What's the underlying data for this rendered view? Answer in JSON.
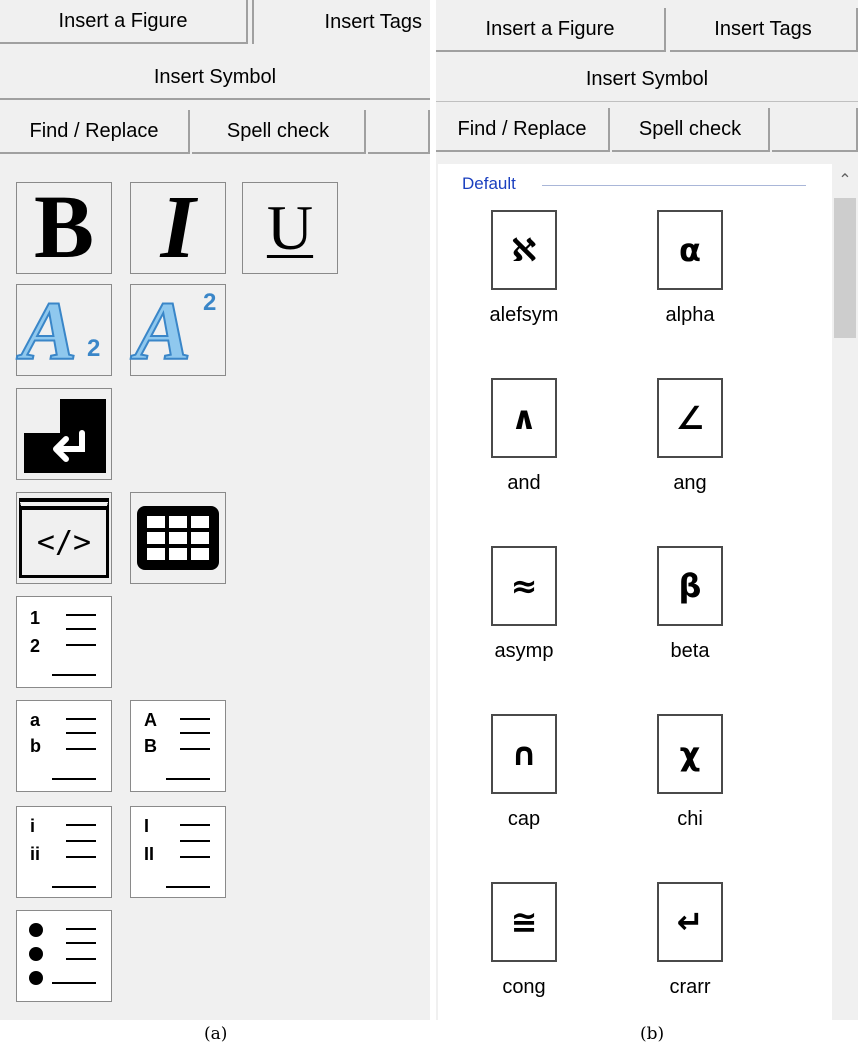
{
  "panel_a": {
    "tabs": [
      "Insert a Figure",
      "Insert Tags"
    ],
    "insert_symbol": "Insert Symbol",
    "buttons": [
      "Find / Replace",
      "Spell check"
    ],
    "tools": {
      "bold": "B",
      "italic": "I",
      "underline": "U",
      "subscript": "A",
      "subscript_mark": "2",
      "superscript": "A",
      "superscript_mark": "2",
      "code": "</>",
      "numbered": [
        "1",
        "2"
      ],
      "alpha_lower": [
        "a",
        "b"
      ],
      "alpha_upper": [
        "A",
        "B"
      ],
      "roman_lower": [
        "i",
        "ii"
      ],
      "roman_upper": [
        "I",
        "II"
      ]
    }
  },
  "panel_b": {
    "tabs": [
      "Insert a Figure",
      "Insert Tags"
    ],
    "insert_symbol": "Insert Symbol",
    "buttons": [
      "Find / Replace",
      "Spell check"
    ],
    "group": "Default",
    "symbols": [
      {
        "glyph": "ℵ",
        "name": "alefsym"
      },
      {
        "glyph": "α",
        "name": "alpha"
      },
      {
        "glyph": "∧",
        "name": "and"
      },
      {
        "glyph": "∠",
        "name": "ang"
      },
      {
        "glyph": "≈",
        "name": "asymp"
      },
      {
        "glyph": "β",
        "name": "beta"
      },
      {
        "glyph": "∩",
        "name": "cap"
      },
      {
        "glyph": "χ",
        "name": "chi"
      },
      {
        "glyph": "≅",
        "name": "cong"
      },
      {
        "glyph": "↵",
        "name": "crarr"
      }
    ]
  },
  "captions": [
    "(a)",
    "(b)"
  ]
}
